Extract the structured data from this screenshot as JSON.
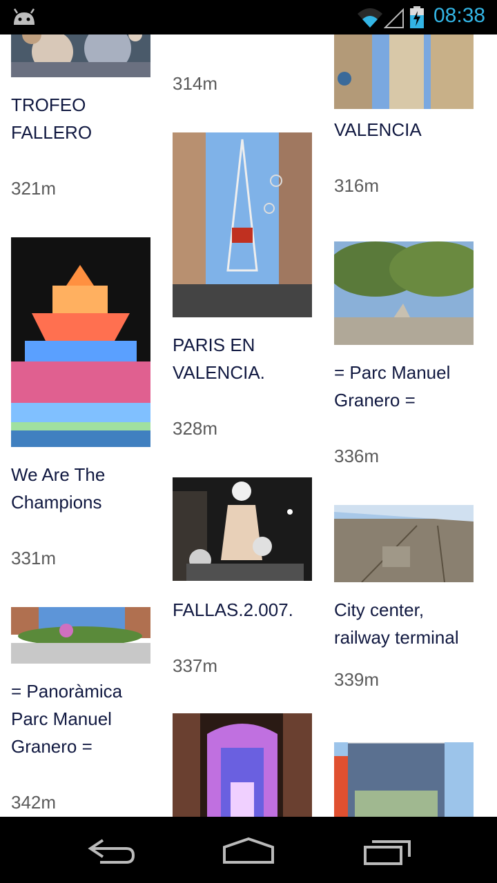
{
  "status_bar": {
    "time": "08:38"
  },
  "columns": [
    [
      {
        "title": "TROFEO FALLERO",
        "distance": "321m",
        "image": "falla-figures"
      },
      {
        "title": "We Are The Champions",
        "distance": "331m",
        "image": "lights-tower"
      },
      {
        "title": "= Panoràmica Parc Manuel Granero =",
        "distance": "342m",
        "image": "park-panorama"
      }
    ],
    [
      {
        "title": "",
        "distance": "314m",
        "image": ""
      },
      {
        "title": "PARIS EN VALENCIA.",
        "distance": "328m",
        "image": "eiffel-street"
      },
      {
        "title": "FALLAS.2.007.",
        "distance": "337m",
        "image": "falla-night"
      },
      {
        "title": "",
        "distance": "",
        "image": "lights-gate"
      }
    ],
    [
      {
        "title": "VALENCIA",
        "distance": "316m",
        "image": "bell-tower"
      },
      {
        "title": "= Parc Manuel Granero =",
        "distance": "336m",
        "image": "park-trees"
      },
      {
        "title": "City center, railway terminal",
        "distance": "339m",
        "image": "aerial-city"
      },
      {
        "title": "",
        "distance": "",
        "image": "building-sign"
      }
    ]
  ],
  "nav": {
    "back": "back-icon",
    "home": "home-icon",
    "recents": "recents-icon"
  }
}
